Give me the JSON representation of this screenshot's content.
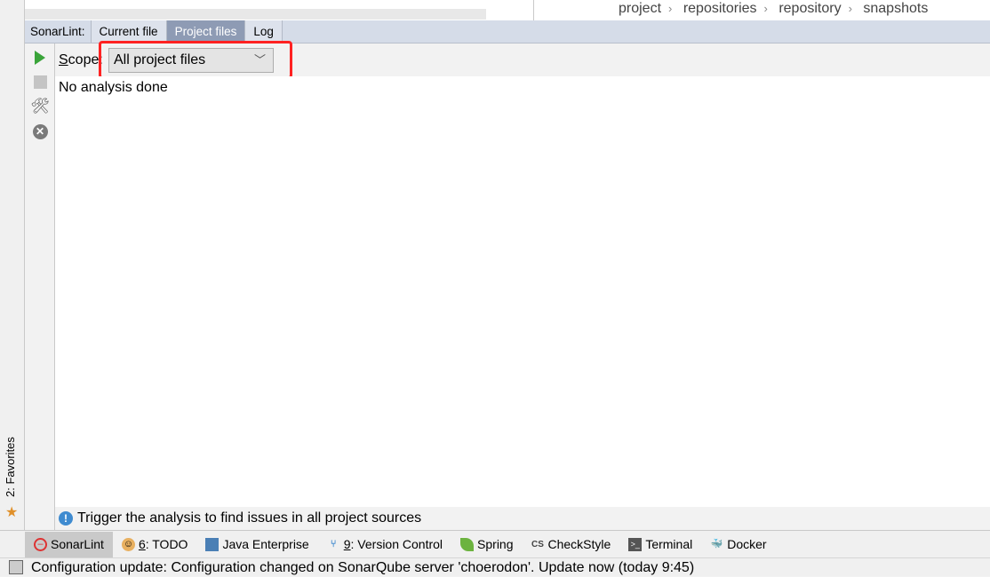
{
  "breadcrumb": [
    "project",
    "repositories",
    "repository",
    "snapshots"
  ],
  "tabs": {
    "prefix": "SonarLint:",
    "items": [
      "Current file",
      "Project files",
      "Log"
    ],
    "active": "Project files"
  },
  "scope": {
    "label": "Scope:",
    "value": "All project files"
  },
  "content": {
    "message": "No analysis done"
  },
  "info": {
    "text": "Trigger the analysis to find issues in all project sources"
  },
  "favorites": {
    "label": "2: Favorites"
  },
  "toolwindows": [
    {
      "label": "SonarLint",
      "icon": "sonarlint-icon"
    },
    {
      "num": "6",
      "label": ": TODO",
      "icon": "todo-icon"
    },
    {
      "label": "Java Enterprise",
      "icon": "java-enterprise-icon"
    },
    {
      "num": "9",
      "label": ": Version Control",
      "icon": "vcs-icon"
    },
    {
      "label": "Spring",
      "icon": "spring-leaf-icon"
    },
    {
      "label": "CheckStyle",
      "icon": "checkstyle-icon"
    },
    {
      "label": "Terminal",
      "icon": "terminal-icon"
    },
    {
      "label": "Docker",
      "icon": "docker-icon"
    }
  ],
  "status": {
    "text": "Configuration update: Configuration changed on SonarQube server 'choerodon'. Update now (today 9:45)"
  },
  "colors": {
    "highlight": "#ff2222",
    "active_tab": "#8e9bb4",
    "run": "#3aa43a"
  }
}
